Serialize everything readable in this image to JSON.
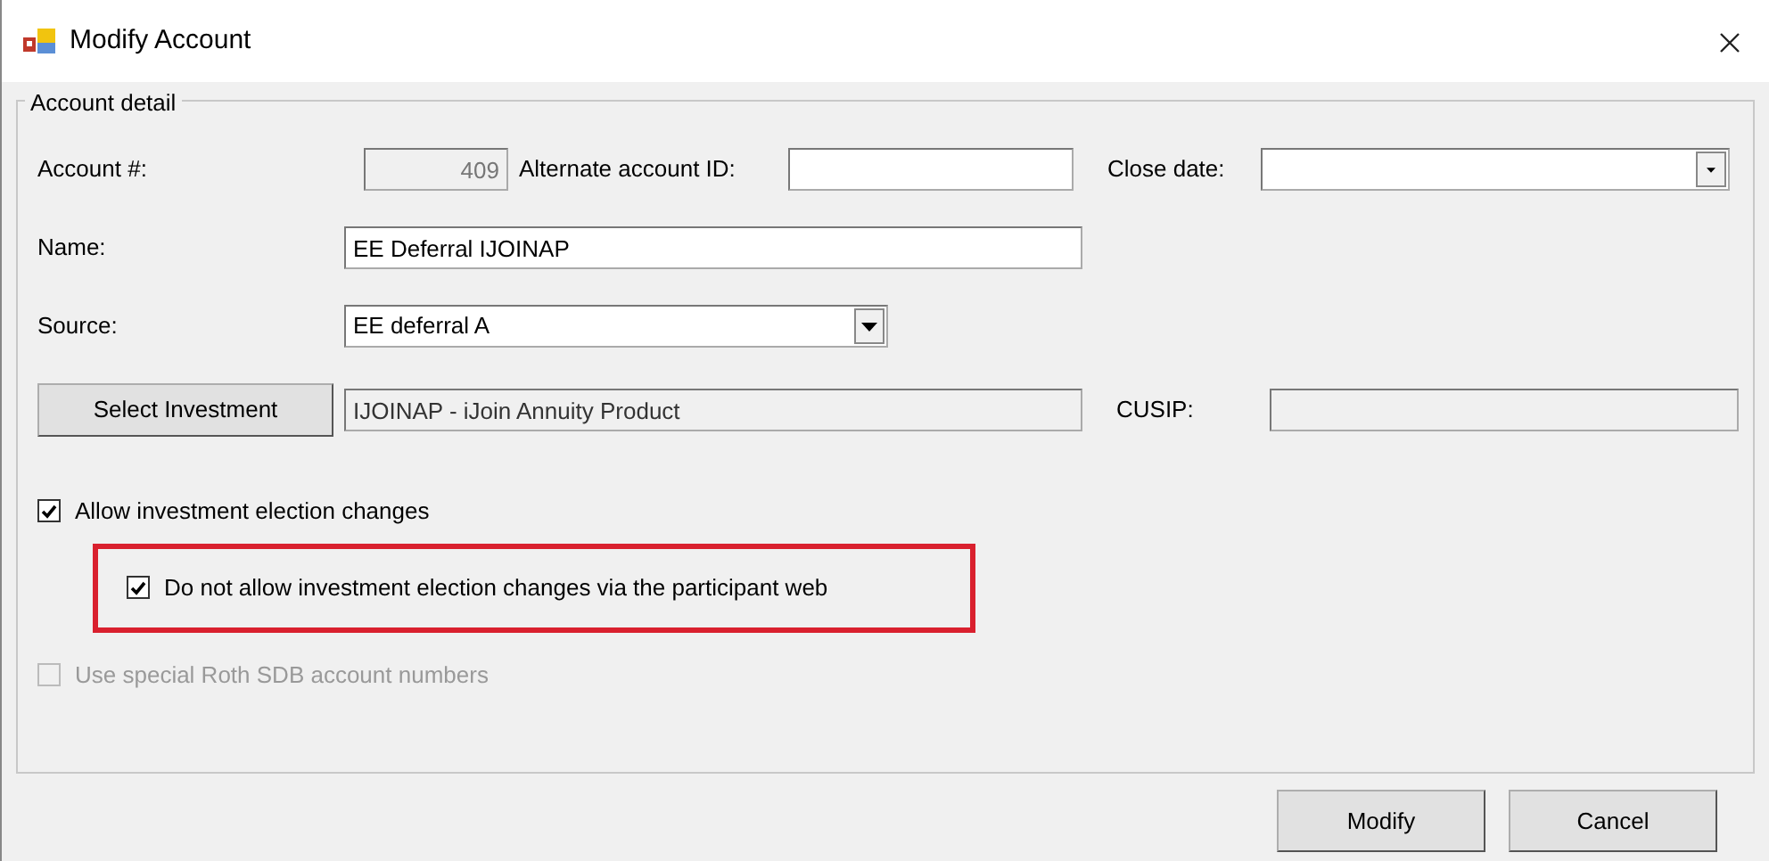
{
  "window": {
    "title": "Modify Account"
  },
  "group": {
    "title": "Account detail"
  },
  "account_number": {
    "label": "Account #:",
    "value": "409",
    "disabled": true
  },
  "alternate_account_id": {
    "label": "Alternate account ID:"
  },
  "close_date": {
    "label": "Close date:"
  },
  "name": {
    "label": "Name:",
    "value": "EE Deferral IJOINAP"
  },
  "source": {
    "label": "Source:",
    "value": "EE deferral A"
  },
  "investment": {
    "button": "Select Investment",
    "value": "IJOINAP - iJoin Annuity Product",
    "disabled": true
  },
  "cusip": {
    "label": "CUSIP:",
    "disabled": true
  },
  "checkboxes": [
    {
      "label": "Allow investment election changes",
      "checked": true,
      "disabled": false,
      "highlighted": false
    },
    {
      "label": "Do not allow investment election changes via the participant web",
      "checked": true,
      "disabled": false,
      "highlighted": true
    },
    {
      "label": "Use special Roth SDB account numbers",
      "checked": false,
      "disabled": true,
      "highlighted": false
    }
  ],
  "buttons": [
    "Modify",
    "Cancel"
  ]
}
